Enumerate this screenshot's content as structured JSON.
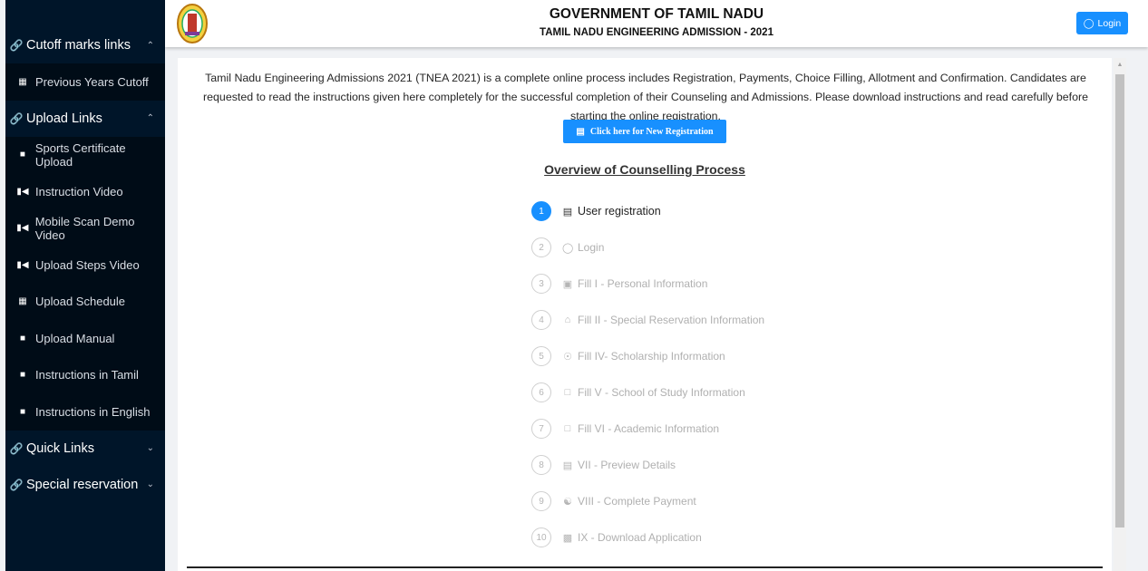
{
  "header": {
    "title": "GOVERNMENT OF TAMIL NADU",
    "subtitle": "TAMIL NADU ENGINEERING ADMISSION - 2021",
    "login_label": "Login"
  },
  "sidebar": {
    "groups": [
      {
        "label": "Cutoff marks links",
        "items": [
          {
            "label": "Previous Years Cutoff"
          }
        ]
      },
      {
        "label": "Upload Links",
        "items": [
          {
            "label": "Sports Certificate Upload"
          },
          {
            "label": "Instruction Video"
          },
          {
            "label": "Mobile Scan Demo Video"
          },
          {
            "label": "Upload Steps Video"
          },
          {
            "label": "Upload Schedule"
          },
          {
            "label": "Upload Manual"
          },
          {
            "label": "Instructions in Tamil"
          },
          {
            "label": "Instructions in English"
          }
        ]
      },
      {
        "label": "Quick Links",
        "items": []
      },
      {
        "label": "Special reservation",
        "items": []
      }
    ]
  },
  "main": {
    "intro": "Tamil Nadu Engineering Admissions 2021 (TNEA 2021) is a complete online process includes Registration, Payments, Choice Filling, Allotment and Confirmation. Candidates are requested to read the instructions given here completely for the successful completion of their Counseling and Admissions. Please download instructions and read carefully before starting the online registration.",
    "register_button": "Click here for New Registration",
    "overview_title": "Overview of Counselling Process",
    "steps": [
      {
        "num": "1",
        "label": "User registration"
      },
      {
        "num": "2",
        "label": "Login"
      },
      {
        "num": "3",
        "label": "Fill I - Personal Information"
      },
      {
        "num": "4",
        "label": "Fill II - Special Reservation Information"
      },
      {
        "num": "5",
        "label": "Fill IV- Scholarship Information"
      },
      {
        "num": "6",
        "label": "Fill V - School of Study Information"
      },
      {
        "num": "7",
        "label": "Fill VI - Academic Information"
      },
      {
        "num": "8",
        "label": "VII - Preview Details"
      },
      {
        "num": "9",
        "label": "VIII - Complete Payment"
      },
      {
        "num": "10",
        "label": "IX - Download Application"
      }
    ]
  },
  "colors": {
    "accent": "#1890ff",
    "sidebar": "#001529",
    "submenu": "#000c17"
  }
}
